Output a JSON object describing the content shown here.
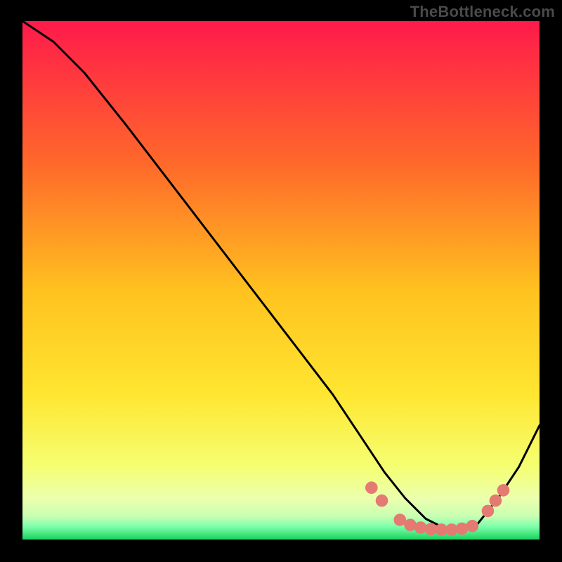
{
  "watermark": "TheBottleneck.com",
  "chart_data": {
    "type": "line",
    "title": "",
    "xlabel": "",
    "ylabel": "",
    "xlim": [
      0,
      100
    ],
    "ylim": [
      0,
      100
    ],
    "grid": false,
    "gradient_colors": {
      "top": "#ff1a4b",
      "upper_mid": "#ff8a1f",
      "mid": "#ffe631",
      "lower_mid": "#f6ff6a",
      "band": "#eaffba",
      "bottom": "#18d45e"
    },
    "series": [
      {
        "name": "curve",
        "color": "#000000",
        "x": [
          0,
          6,
          12,
          20,
          30,
          40,
          50,
          60,
          66,
          70,
          74,
          78,
          82,
          86,
          88,
          92,
          96,
          100
        ],
        "y": [
          100,
          96,
          90,
          80,
          67,
          54,
          41,
          28,
          19,
          13,
          8,
          4,
          2,
          2,
          3,
          8,
          14,
          22
        ]
      }
    ],
    "markers": {
      "name": "dots",
      "color": "#e47a72",
      "radius": 1.2,
      "points": [
        {
          "x": 67.5,
          "y": 10.0
        },
        {
          "x": 69.5,
          "y": 7.5
        },
        {
          "x": 73.0,
          "y": 3.8
        },
        {
          "x": 75.0,
          "y": 2.8
        },
        {
          "x": 77.0,
          "y": 2.3
        },
        {
          "x": 79.0,
          "y": 2.0
        },
        {
          "x": 81.0,
          "y": 1.9
        },
        {
          "x": 83.0,
          "y": 1.9
        },
        {
          "x": 85.0,
          "y": 2.1
        },
        {
          "x": 87.0,
          "y": 2.6
        },
        {
          "x": 90.0,
          "y": 5.5
        },
        {
          "x": 91.5,
          "y": 7.5
        },
        {
          "x": 93.0,
          "y": 9.5
        }
      ]
    }
  }
}
